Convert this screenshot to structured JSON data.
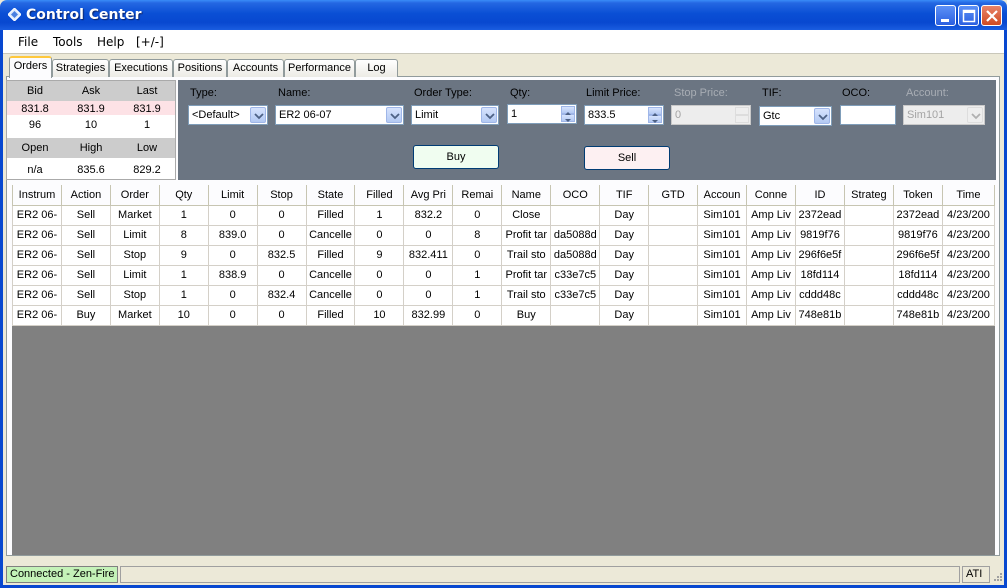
{
  "window": {
    "title": "Control Center"
  },
  "menu": [
    "File",
    "Tools",
    "Help",
    "[+/-]"
  ],
  "tabs": [
    "Orders",
    "Strategies",
    "Executions",
    "Positions",
    "Accounts",
    "Performance",
    "Log"
  ],
  "quote": {
    "bid_label": "Bid",
    "ask_label": "Ask",
    "last_label": "Last",
    "bid": "831.8",
    "ask": "831.9",
    "last": "831.9",
    "bid_size": "96",
    "ask_size": "10",
    "last_size": "1",
    "open_label": "Open",
    "high_label": "High",
    "low_label": "Low",
    "open": "n/a",
    "high": "835.6",
    "low": "829.2"
  },
  "entry": {
    "type_label": "Type:",
    "type_value": "<Default>",
    "name_label": "Name:",
    "name_value": "ER2 06-07",
    "order_type_label": "Order Type:",
    "order_type_value": "Limit",
    "qty_label": "Qty:",
    "qty_value": "1",
    "limit_label": "Limit Price:",
    "limit_value": "833.5",
    "stop_label": "Stop Price:",
    "stop_value": "0",
    "tif_label": "TIF:",
    "tif_value": "Gtc",
    "oco_label": "OCO:",
    "oco_value": "",
    "account_label": "Account:",
    "account_value": "Sim101",
    "buy_label": "Buy",
    "sell_label": "Sell"
  },
  "grid": {
    "columns": [
      "Instrum",
      "Action",
      "Order",
      "Qty",
      "Limit",
      "Stop",
      "State",
      "Filled",
      "Avg Pri",
      "Remai",
      "Name",
      "OCO",
      "TIF",
      "GTD",
      "Accoun",
      "Conne",
      "ID",
      "Strateg",
      "Token",
      "Time"
    ],
    "rows": [
      [
        "ER2 06-",
        "Sell",
        "Market",
        "1",
        "0",
        "0",
        "Filled",
        "1",
        "832.2",
        "0",
        "Close",
        "",
        "Day",
        "",
        "Sim101",
        "Amp Liv",
        "2372ead",
        "",
        "2372ead",
        "4/23/200"
      ],
      [
        "ER2 06-",
        "Sell",
        "Limit",
        "8",
        "839.0",
        "0",
        "Cancelle",
        "0",
        "0",
        "8",
        "Profit tar",
        "da5088d",
        "Day",
        "",
        "Sim101",
        "Amp Liv",
        "9819f76",
        "",
        "9819f76",
        "4/23/200"
      ],
      [
        "ER2 06-",
        "Sell",
        "Stop",
        "9",
        "0",
        "832.5",
        "Filled",
        "9",
        "832.411",
        "0",
        "Trail sto",
        "da5088d",
        "Day",
        "",
        "Sim101",
        "Amp Liv",
        "296f6e5f",
        "",
        "296f6e5f",
        "4/23/200"
      ],
      [
        "ER2 06-",
        "Sell",
        "Limit",
        "1",
        "838.9",
        "0",
        "Cancelle",
        "0",
        "0",
        "1",
        "Profit tar",
        "c33e7c5",
        "Day",
        "",
        "Sim101",
        "Amp Liv",
        "18fd114",
        "",
        "18fd114",
        "4/23/200"
      ],
      [
        "ER2 06-",
        "Sell",
        "Stop",
        "1",
        "0",
        "832.4",
        "Cancelle",
        "0",
        "0",
        "1",
        "Trail sto",
        "c33e7c5",
        "Day",
        "",
        "Sim101",
        "Amp Liv",
        "cddd48c",
        "",
        "cddd48c",
        "4/23/200"
      ],
      [
        "ER2 06-",
        "Buy",
        "Market",
        "10",
        "0",
        "0",
        "Filled",
        "10",
        "832.99",
        "0",
        "Buy",
        "",
        "Day",
        "",
        "Sim101",
        "Amp Liv",
        "748e81b",
        "",
        "748e81b",
        "4/23/200"
      ]
    ]
  },
  "status": {
    "connection": "Connected - Zen-Fire",
    "right": "ATI"
  },
  "colors": {
    "titlebar": "#0a4fd5",
    "entry_panel": "#6b7582",
    "connected": "#c4f2b8",
    "bid_row": "#fde2e6"
  }
}
